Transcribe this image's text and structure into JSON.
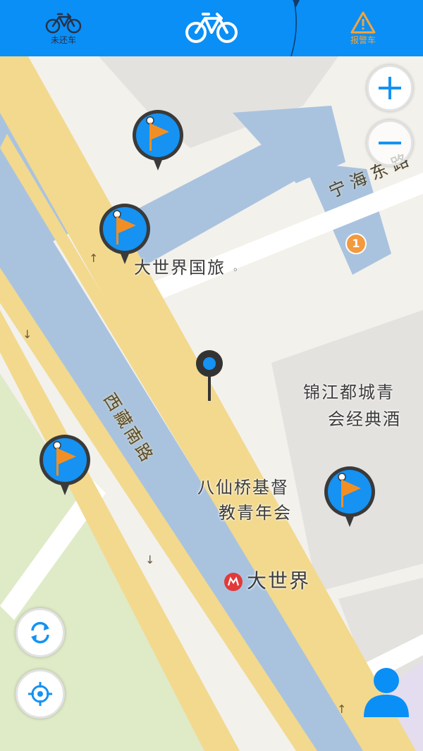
{
  "header": {
    "tab_unreturned_label": "未还车",
    "tab_alarm_label": "报警车",
    "icons": {
      "unreturned": "bicycle-outline-icon",
      "current": "bicycle-icon",
      "alarm": "warning-triangle-icon"
    },
    "colors": {
      "bar": "#0a8ff6",
      "alarm": "#f4a43a"
    }
  },
  "map": {
    "labels": {
      "travel": "大世界国旅",
      "hotel_line1": "锦江都城青",
      "hotel_line2": "会经典酒",
      "church_line1": "八仙桥基督",
      "church_line2": "教青年会",
      "metro": "大世界",
      "poi_number": "1"
    },
    "roads": {
      "xizang": "西藏南路",
      "ninghai": "宁海东路"
    },
    "markers": [
      "flag-pin",
      "flag-pin",
      "flag-pin",
      "flag-pin",
      "location-pin"
    ]
  },
  "controls": {
    "zoom_in": "zoom-in-icon",
    "zoom_out": "zoom-out-icon",
    "refresh": "refresh-icon",
    "locate": "crosshair-icon",
    "profile": "user-icon"
  }
}
